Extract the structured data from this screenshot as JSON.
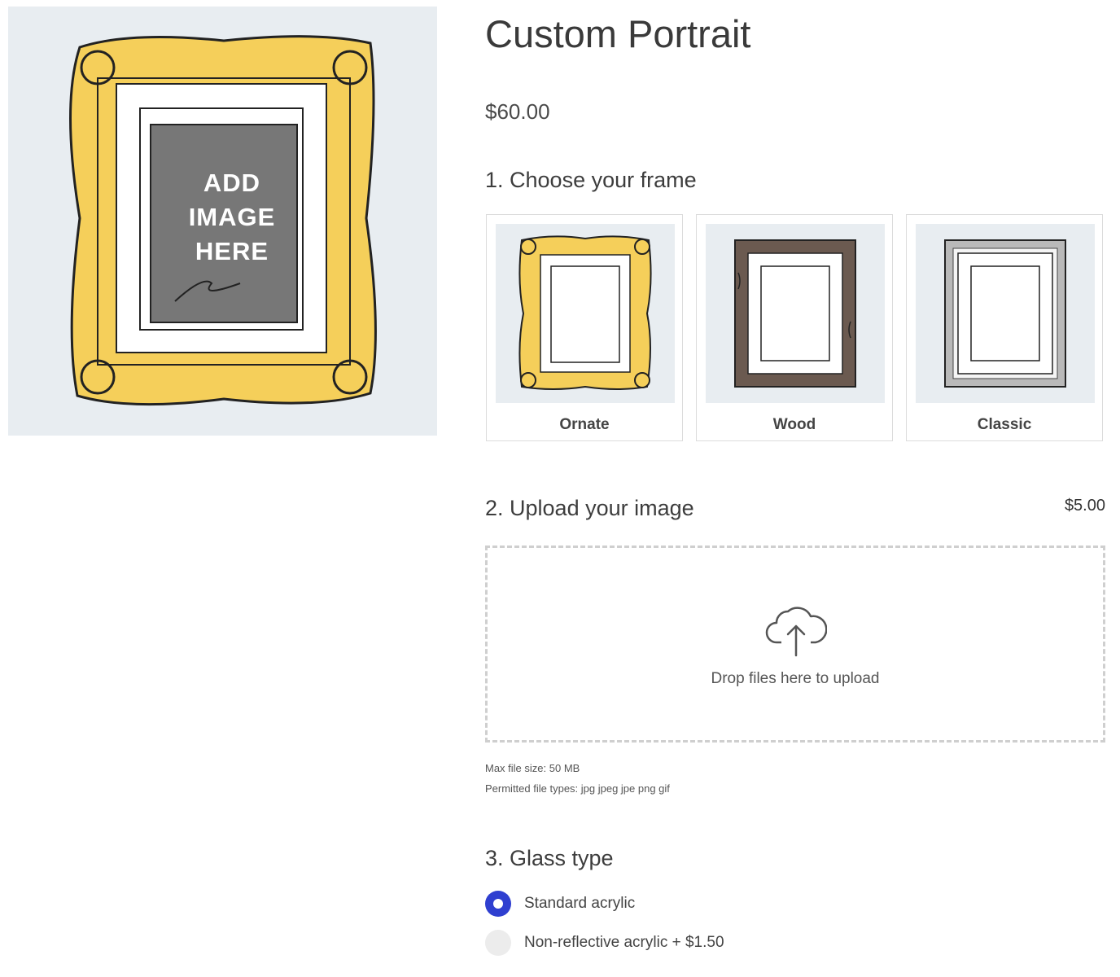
{
  "hero": {
    "lines": [
      "ADD",
      "IMAGE",
      "HERE"
    ],
    "icon": "ornate-frame-illustration"
  },
  "product": {
    "title": "Custom Portrait",
    "price": "$60.00"
  },
  "step1": {
    "heading": "1. Choose your frame",
    "options": [
      {
        "label": "Ornate",
        "icon": "ornate-frame-icon"
      },
      {
        "label": "Wood",
        "icon": "wood-frame-icon"
      },
      {
        "label": "Classic",
        "icon": "classic-frame-icon"
      }
    ]
  },
  "step2": {
    "heading": "2. Upload your image",
    "price": "$5.00",
    "drop_text": "Drop files here to upload",
    "drop_icon": "cloud-upload-icon",
    "max_size": "Max file size: 50 MB",
    "types": "Permitted file types: jpg jpeg jpe png gif"
  },
  "step3": {
    "heading": "3. Glass type",
    "options": [
      {
        "label": "Standard acrylic",
        "selected": true
      },
      {
        "label": "Non-reflective acrylic + $1.50",
        "selected": false
      }
    ]
  },
  "colors": {
    "accent": "#2f3fd0",
    "gold": "#f5cf5a",
    "wood": "#6b5a50",
    "silver": "#b9b9b9",
    "panel": "#e8edf1"
  }
}
